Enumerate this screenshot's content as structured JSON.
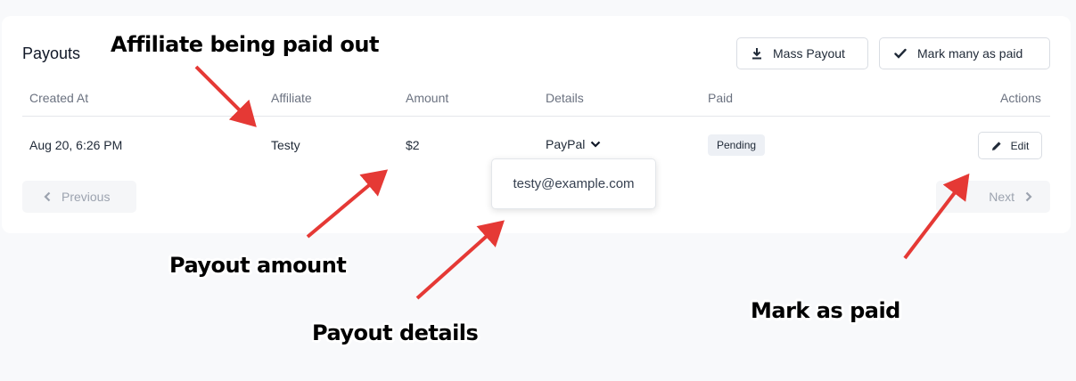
{
  "card": {
    "title": "Payouts",
    "mass_payout_label": "Mass Payout",
    "mark_many_label": "Mark many as paid"
  },
  "table": {
    "columns": [
      "Created At",
      "Affiliate",
      "Amount",
      "Details",
      "Paid",
      "Actions"
    ],
    "rows": [
      {
        "created_at": "Aug 20, 6:26 PM",
        "affiliate": "Testy",
        "amount": "$2",
        "details": "PayPal",
        "paid_status": "Pending",
        "edit_label": "Edit"
      }
    ]
  },
  "popover": {
    "email": "testy@example.com"
  },
  "pagination": {
    "previous_label": "Previous",
    "next_label": "Next"
  },
  "annotations": {
    "affiliate": "Affiliate being paid out",
    "amount": "Payout amount",
    "details": "Payout details",
    "mark_paid": "Mark as paid"
  },
  "colors": {
    "arrow": "#e53935",
    "page_background": "#f8f9fb",
    "badge_background": "#edf0f5"
  }
}
